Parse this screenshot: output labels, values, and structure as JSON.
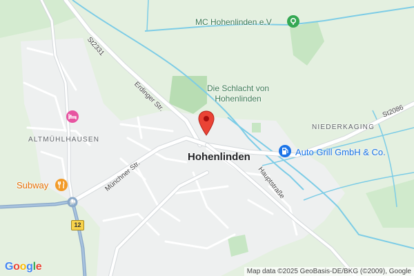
{
  "map": {
    "town_label": "Hohenlinden",
    "place_labels": {
      "altmuehlhausen": "ALTMÜHLHAUSEN",
      "niederkaging": "NIEDERKAGING"
    },
    "pois": {
      "mc_club": "MC Hohenlinden e.V",
      "battle_line1": "Die Schlacht von",
      "battle_line2": "Hohenlinden",
      "auto_grill": "Auto Grill GmbH & Co.",
      "subway": "Subway"
    },
    "roads": {
      "st2331": "St2331",
      "erdinger": "Erdinger Str.",
      "muenchner": "Münchner Str.",
      "haupt": "Hauptstraße",
      "st2086": "St2086",
      "route12": "12"
    },
    "icons": {
      "pin": "map-pin-icon",
      "poi_green": "landmark-icon",
      "fuel": "fuel-station-icon",
      "food": "restaurant-icon",
      "hotel": "hotel-icon"
    },
    "colors": {
      "land": "#e4f0e0",
      "forest": "#c7e6c4",
      "urban": "#eef0f0",
      "water": "#7ccce6",
      "road_major": "#ffffff",
      "road_highway": "#8aa8c8",
      "pin": "#ea4335",
      "poi_green": "#34a853",
      "poi_blue": "#1a73e8",
      "poi_orange": "#f29b28",
      "hotel": "#e754a1"
    },
    "attribution": "Map data ©2025 GeoBasis-DE/BKG (©2009), Google",
    "logo": "Google"
  }
}
